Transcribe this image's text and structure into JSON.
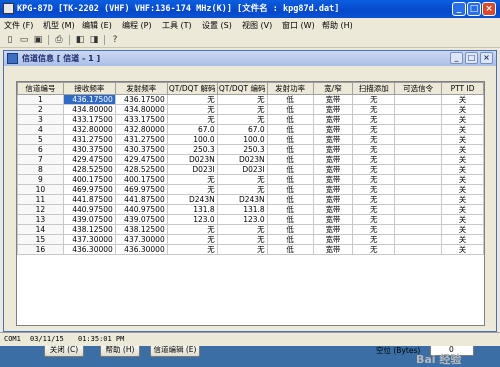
{
  "window": {
    "title": "KPG-87D [TK-2202 (VHF) VHF:136-174 MHz(K)] [文件名 : kpg87d.dat]",
    "minimize": "_",
    "maximize": "□",
    "close": "×"
  },
  "menus": [
    "文件 (F)",
    "机型 (M)",
    "编辑 (E)",
    "编程 (P)",
    "工具 (T)",
    "设置 (S)",
    "视图 (V)",
    "窗口 (W)",
    "帮助 (H)"
  ],
  "toolbar_icons": [
    "new-file-icon",
    "open-folder-icon",
    "save-disk-icon",
    "print-icon",
    "read-radio-icon",
    "write-radio-icon",
    "help-icon"
  ],
  "child": {
    "title": "信道信息 [ 信道 - 1 ]",
    "minimize": "_",
    "maximize": "□",
    "close": "×"
  },
  "table": {
    "headers": [
      "信道编号",
      "接收频率",
      "发射频率",
      "QT/DQT 解码",
      "QT/DQT 编码",
      "发射功率",
      "宽/窄",
      "扫描添加",
      "可选信令",
      "PTT ID"
    ],
    "rows": [
      [
        "1",
        "436.17500",
        "436.17500",
        "无",
        "无",
        "低",
        "宽带",
        "无",
        "",
        "关"
      ],
      [
        "2",
        "434.80000",
        "434.80000",
        "无",
        "无",
        "低",
        "宽带",
        "无",
        "",
        "关"
      ],
      [
        "3",
        "433.17500",
        "433.17500",
        "无",
        "无",
        "低",
        "宽带",
        "无",
        "",
        "关"
      ],
      [
        "4",
        "432.80000",
        "432.80000",
        "67.0",
        "67.0",
        "低",
        "宽带",
        "无",
        "",
        "关"
      ],
      [
        "5",
        "431.27500",
        "431.27500",
        "100.0",
        "100.0",
        "低",
        "宽带",
        "无",
        "",
        "关"
      ],
      [
        "6",
        "430.37500",
        "430.37500",
        "250.3",
        "250.3",
        "低",
        "宽带",
        "无",
        "",
        "关"
      ],
      [
        "7",
        "429.47500",
        "429.47500",
        "D023N",
        "D023N",
        "低",
        "宽带",
        "无",
        "",
        "关"
      ],
      [
        "8",
        "428.52500",
        "428.52500",
        "D023I",
        "D023I",
        "低",
        "宽带",
        "无",
        "",
        "关"
      ],
      [
        "9",
        "400.17500",
        "400.17500",
        "无",
        "无",
        "低",
        "宽带",
        "无",
        "",
        "关"
      ],
      [
        "10",
        "469.97500",
        "469.97500",
        "无",
        "无",
        "低",
        "宽带",
        "无",
        "",
        "关"
      ],
      [
        "11",
        "441.87500",
        "441.87500",
        "D243N",
        "D243N",
        "低",
        "宽带",
        "无",
        "",
        "关"
      ],
      [
        "12",
        "440.97500",
        "440.97500",
        "131.8",
        "131.8",
        "低",
        "宽带",
        "无",
        "",
        "关"
      ],
      [
        "13",
        "439.07500",
        "439.07500",
        "123.0",
        "123.0",
        "低",
        "宽带",
        "无",
        "",
        "关"
      ],
      [
        "14",
        "438.12500",
        "438.12500",
        "无",
        "无",
        "低",
        "宽带",
        "无",
        "",
        "关"
      ],
      [
        "15",
        "437.30000",
        "437.30000",
        "无",
        "无",
        "低",
        "宽带",
        "无",
        "",
        "关"
      ],
      [
        "16",
        "436.30000",
        "436.30000",
        "无",
        "无",
        "低",
        "宽带",
        "无",
        "",
        "关"
      ]
    ]
  },
  "buttons": {
    "close": "关闭 (C)",
    "help": "帮助 (H)",
    "channel_edit": "信道编辑 (E)"
  },
  "space": {
    "label": "空位 (Bytes)",
    "value": "0"
  },
  "status": {
    "port": "COM1",
    "date": "03/11/15",
    "time": "01:35:01 PM"
  },
  "watermark": "Bai 经验"
}
